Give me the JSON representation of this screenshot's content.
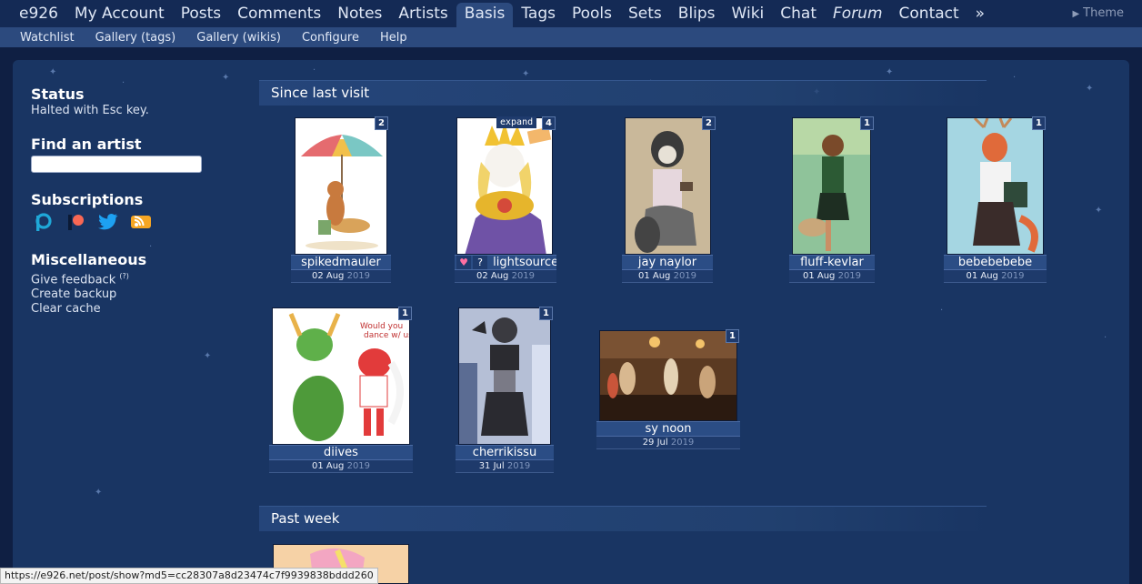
{
  "topnav": {
    "items": [
      "e926",
      "My Account",
      "Posts",
      "Comments",
      "Notes",
      "Artists",
      "Basis",
      "Tags",
      "Pools",
      "Sets",
      "Blips",
      "Wiki",
      "Chat",
      "Forum",
      "Contact",
      "»"
    ],
    "active": "Basis",
    "theme_label": "Theme"
  },
  "subnav": {
    "items": [
      "Watchlist",
      "Gallery (tags)",
      "Gallery (wikis)",
      "Configure",
      "Help"
    ]
  },
  "sidebar": {
    "status_title": "Status",
    "status_text": "Halted with Esc key.",
    "find_title": "Find an artist",
    "find_value": "",
    "subs_title": "Subscriptions",
    "subs_icons": [
      "picarto-icon",
      "patreon-icon",
      "twitter-icon",
      "rss-icon"
    ],
    "misc_title": "Miscellaneous",
    "misc_links": [
      "Give feedback",
      "Create backup",
      "Clear cache"
    ],
    "feedback_sup": "(?)"
  },
  "sections": {
    "since_last_visit": "Since last visit",
    "past_week": "Past week"
  },
  "posts": [
    {
      "artist": "spikedmauler",
      "day": "02 Aug",
      "year": "2019",
      "count": "2"
    },
    {
      "artist": "lightsource",
      "day": "02 Aug",
      "year": "2019",
      "count": "4",
      "expand": "expand",
      "fav": "♥",
      "q": "?"
    },
    {
      "artist": "jay naylor",
      "day": "01 Aug",
      "year": "2019",
      "count": "2"
    },
    {
      "artist": "fluff-kevlar",
      "day": "01 Aug",
      "year": "2019",
      "count": "1"
    },
    {
      "artist": "bebebebebe",
      "day": "01 Aug",
      "year": "2019",
      "count": "1"
    },
    {
      "artist": "diives",
      "day": "01 Aug",
      "year": "2019",
      "count": "1"
    },
    {
      "artist": "cherrikissu",
      "day": "31 Jul",
      "year": "2019",
      "count": "1"
    },
    {
      "artist": "sy noon",
      "day": "29 Jul",
      "year": "2019",
      "count": "1"
    }
  ],
  "statusbar": {
    "url": "https://e926.net/post/show?md5=cc28307a8d23474c7f9939838bddd260"
  },
  "colors": {
    "background": "#0f1f43",
    "panel": "#193563",
    "nav": "#142a55",
    "subnav": "#2c4a7e"
  }
}
